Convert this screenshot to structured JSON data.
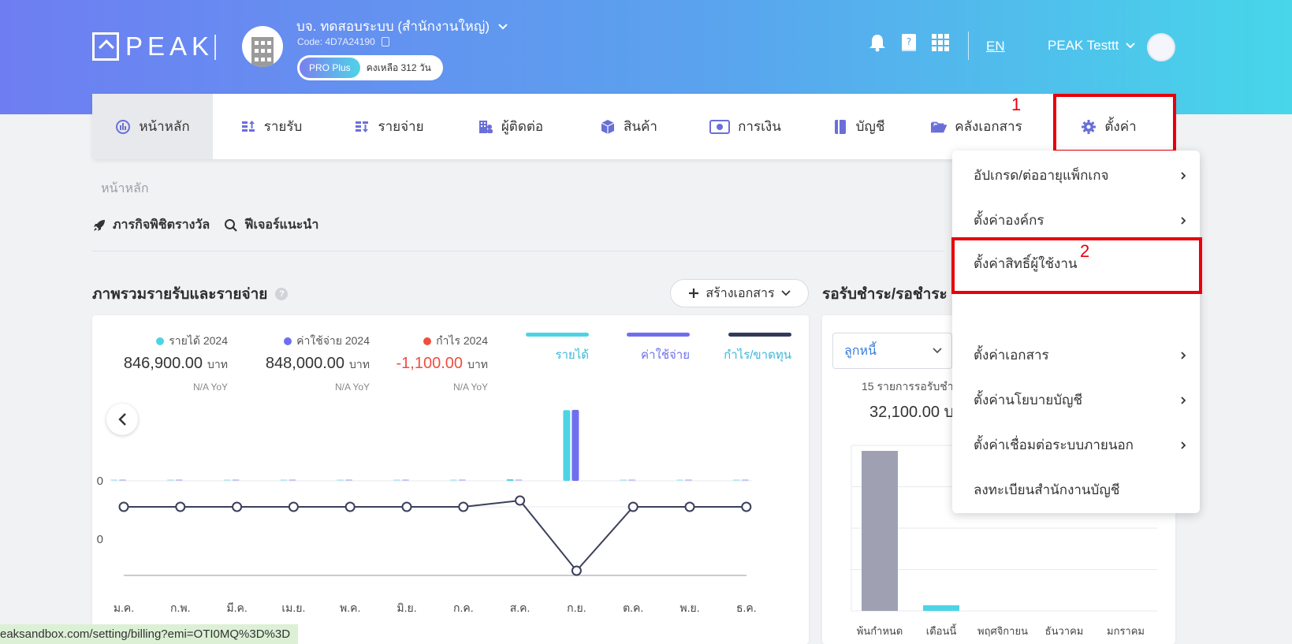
{
  "brand": {
    "logo_text": "PEAK"
  },
  "company": {
    "name": "บจ. ทดสอบระบบ (สำนักงานใหญ่)",
    "code": "Code: 4D7A24190",
    "plan": "PRO Plus",
    "remaining": "คงเหลือ 312 วัน"
  },
  "header": {
    "language": "EN",
    "user_name": "PEAK Testtt"
  },
  "nav": {
    "items": [
      {
        "label": "หน้าหลัก",
        "icon": "dashboard-icon"
      },
      {
        "label": "รายรับ",
        "icon": "income-icon"
      },
      {
        "label": "รายจ่าย",
        "icon": "expense-icon"
      },
      {
        "label": "ผู้ติดต่อ",
        "icon": "contacts-icon"
      },
      {
        "label": "สินค้า",
        "icon": "box-icon"
      },
      {
        "label": "การเงิน",
        "icon": "money-icon"
      },
      {
        "label": "บัญชี",
        "icon": "book-icon"
      },
      {
        "label": "คลังเอกสาร",
        "icon": "folder-icon"
      },
      {
        "label": "ตั้งค่า",
        "icon": "gear-icon"
      }
    ]
  },
  "annotations": {
    "mark1": "1",
    "mark2": "2"
  },
  "breadcrumb": "หน้าหลัก",
  "quick_links": {
    "missions": "ภารกิจพิชิตรางวัล",
    "features": "ฟีเจอร์แนะนำ"
  },
  "overview": {
    "title": "ภาพรวมรายรับและรายจ่าย",
    "create_button": "สร้างเอกสาร",
    "stats": [
      {
        "label": "รายได้ 2024",
        "value": "846,900.00",
        "unit": "บาท",
        "yoy": "N/A YoY",
        "color": "#4dd4e4"
      },
      {
        "label": "ค่าใช้จ่าย 2024",
        "value": "848,000.00",
        "unit": "บาท",
        "yoy": "N/A YoY",
        "color": "#6f6ef0"
      },
      {
        "label": "กำไร 2024",
        "value": "-1,100.00",
        "unit": "บาท",
        "yoy": "N/A YoY",
        "color": "#f04e3e"
      }
    ],
    "legend": [
      {
        "label": "รายได้",
        "color": "#4dd4e4"
      },
      {
        "label": "ค่าใช้จ่าย",
        "color": "#6f6ef0"
      },
      {
        "label": "กำไร/ขาดทุน",
        "color": "#333a5a"
      }
    ]
  },
  "receivables": {
    "title": "รอรับชำระ/รอชำระ",
    "select_value": "ลูกหนี้",
    "count_text": "15 รายการรอรับชำ",
    "total_text": "32,100.00 บ"
  },
  "settings_menu": {
    "items": [
      {
        "label": "อัปเกรด/ต่ออายุแพ็กเกจ",
        "has_arrow": true
      },
      {
        "label": "ตั้งค่าองค์กร",
        "has_arrow": true
      },
      {
        "label": "ตั้งค่าสิทธิ์ผู้ใช้งาน",
        "has_arrow": false
      },
      {
        "label": "ตั้งค่าเอกสาร",
        "has_arrow": true
      },
      {
        "label": "ตั้งค่านโยบายบัญชี",
        "has_arrow": true
      },
      {
        "label": "ตั้งค่าเชื่อมต่อระบบภายนอก",
        "has_arrow": true
      },
      {
        "label": "ลงทะเบียนสำนักงานบัญชี",
        "has_arrow": false
      }
    ]
  },
  "status_bar": {
    "url": "eaksandbox.com/setting/billing?emi=OTI0MQ%3D%3D"
  },
  "chart_data": [
    {
      "type": "bar",
      "categories": [
        "ม.ค.",
        "ก.พ.",
        "มี.ค.",
        "เม.ย.",
        "พ.ค.",
        "มิ.ย.",
        "ก.ค.",
        "ส.ค.",
        "ก.ย.",
        "ต.ค.",
        "พ.ย.",
        "ธ.ค."
      ],
      "series": [
        {
          "name": "รายได้",
          "values": [
            0,
            0,
            0,
            0,
            0,
            0,
            0,
            2000,
            844900,
            0,
            0,
            0
          ]
        },
        {
          "name": "ค่าใช้จ่าย",
          "values": [
            0,
            0,
            0,
            0,
            0,
            0,
            0,
            0,
            848000,
            0,
            0,
            0
          ]
        },
        {
          "name": "กำไร/ขาดทุน",
          "values": [
            0,
            0,
            0,
            0,
            0,
            0,
            0,
            2000,
            -3100,
            0,
            0,
            0
          ]
        }
      ],
      "tick_labels": [
        "0",
        "0"
      ]
    },
    {
      "type": "bar",
      "categories": [
        "พ้นกำหนด",
        "เดือนนี้",
        "พฤศจิกายน",
        "ธันวาคม",
        "มกราคม"
      ],
      "values": [
        31000,
        1100,
        0,
        0,
        0
      ]
    }
  ]
}
